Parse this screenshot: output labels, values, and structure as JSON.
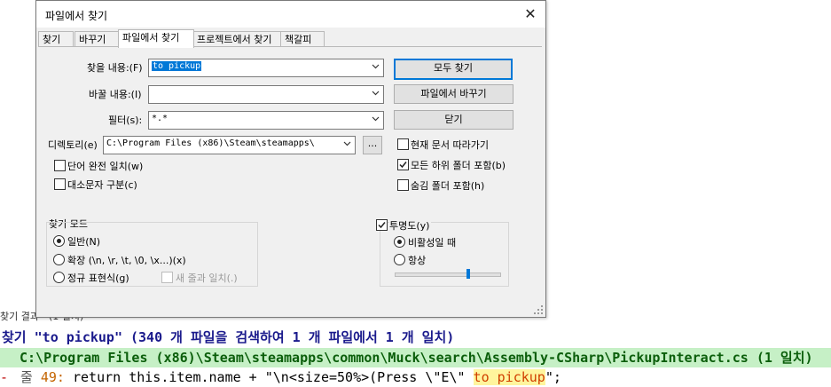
{
  "results": {
    "panel_title": "찾기 결과 - (1 일치)",
    "summary": "찾기 \"to pickup\" (340 개 파일을 검색하여 1 개 파일에서 1 개 일치)",
    "file_path": "C:\\Program Files (x86)\\Steam\\steamapps\\common\\Muck\\search\\Assembly-CSharp\\PickupInteract.cs (1 일치)",
    "line_marker": "-",
    "line_label": "줄",
    "line_number": "49:",
    "code_before": "       return this.item.name + \"\\n<size=50%>(Press \\\"E\\\" ",
    "code_match": "to pickup",
    "code_after": "\";"
  },
  "dialog": {
    "title": "파일에서 찾기",
    "tabs": [
      {
        "label": "찾기"
      },
      {
        "label": "바꾸기"
      },
      {
        "label": "파일에서 찾기"
      },
      {
        "label": "프로젝트에서 찾기"
      },
      {
        "label": "책갈피"
      }
    ],
    "find_label": "찾을 내용:(F)",
    "find_value": "to pickup",
    "replace_label": "바꿀 내용:(I)",
    "replace_value": "",
    "filter_label": "필터(s):",
    "filter_value": "*.*",
    "dir_label": "디렉토리(e)",
    "dir_value": "C:\\Program Files (x86)\\Steam\\steamapps\\",
    "browse_label": "...",
    "btn_find_all": "모두 찾기",
    "btn_replace_in_files": "파일에서 바꾸기",
    "btn_close": "닫기",
    "cb_follow_doc": "현재 문서 따라가기",
    "cb_subfolders": "모든 하위 폴더 포함(b)",
    "cb_hidden": "숨김 폴더 포함(h)",
    "cb_whole_word": "단어 완전 일치(w)",
    "cb_match_case": "대소문자 구분(c)",
    "mode_title": "찾기 모드",
    "mode_normal": "일반(N)",
    "mode_extended": "확장 (\\n, \\r, \\t, \\0, \\x...)(x)",
    "mode_regex": "정규 표현식(g)",
    "mode_dot_newline": "새 줄과 일치(.)",
    "transparency_label": "투명도(y)",
    "trans_on_inactive": "비활성일 때",
    "trans_always": "항상",
    "states": {
      "follow_doc": false,
      "subfolders": true,
      "hidden": false,
      "whole_word": false,
      "match_case": false,
      "transparency": true,
      "mode": "normal",
      "trans_mode": "inactive",
      "slider_level": 0.7
    }
  }
}
